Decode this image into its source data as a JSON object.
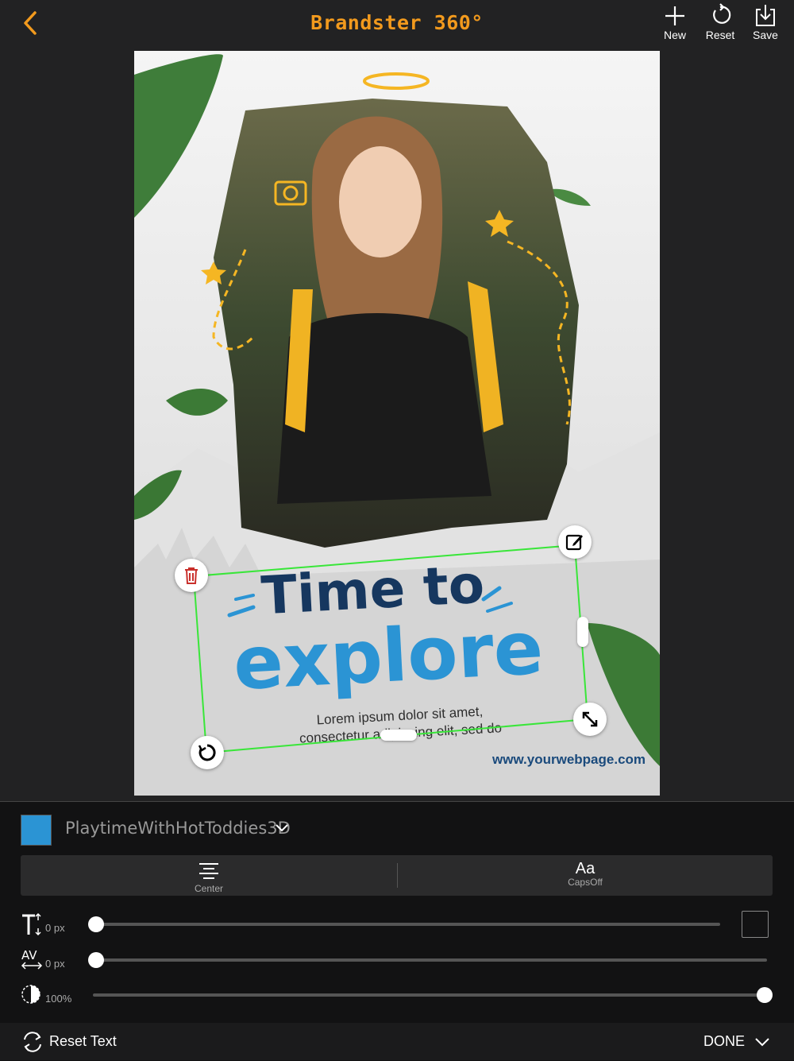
{
  "app": {
    "title": "Brandster 360°"
  },
  "toolbar": {
    "new_label": "New",
    "reset_label": "Reset",
    "save_label": "Save"
  },
  "design": {
    "headline_line1": "Time to",
    "headline_line2": "explore",
    "body_line1": "Lorem ipsum dolor sit amet,",
    "body_line2": "consectetur adipiscing elit, sed do",
    "website": "www.yourwebpage.com"
  },
  "text_panel": {
    "font_color": "#2b94d4",
    "font_name": "PlaytimeWithHotToddies3D",
    "align_label": "Center",
    "caps_icon": "Aa",
    "caps_label": "CapsOff",
    "line_spacing_value": "0 px",
    "letter_spacing_value": "0 px",
    "opacity_value": "100%",
    "line_spacing": 0,
    "letter_spacing": 0,
    "opacity": 1.0
  },
  "footer": {
    "reset_text_label": "Reset Text",
    "done_label": "DONE"
  },
  "icons": [
    "back-chevron-icon",
    "plus-icon",
    "reset-icon",
    "save-icon",
    "trash-icon",
    "edit-icon",
    "resize-icon",
    "rotate-icon",
    "chevron-down-icon",
    "align-center-icon",
    "line-spacing-icon",
    "letter-spacing-icon",
    "opacity-icon",
    "refresh-icon"
  ],
  "colors": {
    "accent": "#f29a1d",
    "selection": "#39e639",
    "headline_dark": "#16375f",
    "headline_blue": "#2b94d4"
  }
}
